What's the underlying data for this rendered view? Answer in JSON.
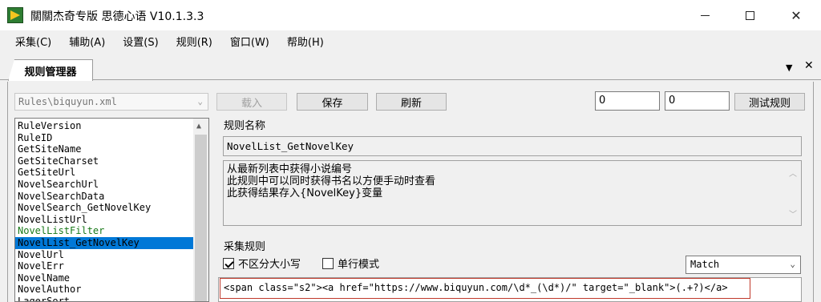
{
  "window": {
    "title": "關關杰奇专版 思德心语 V10.1.3.3",
    "minimize": "—",
    "maximize": "☐",
    "close": "✕"
  },
  "menu": {
    "items": [
      "采集(C)",
      "辅助(A)",
      "设置(S)",
      "规则(R)",
      "窗口(W)",
      "帮助(H)"
    ]
  },
  "tabs": {
    "active": "规则管理器",
    "dropdown_glyph": "▼",
    "close_glyph": "✕"
  },
  "toolbar": {
    "rule_file": "Rules\\biquyun.xml",
    "load_label": "载入",
    "save_label": "保存",
    "refresh_label": "刷新",
    "num1": "0",
    "num2": "0",
    "test_label": "测试规则"
  },
  "rule_list": {
    "items": [
      {
        "label": "RuleVersion",
        "state": "normal"
      },
      {
        "label": "RuleID",
        "state": "normal"
      },
      {
        "label": "GetSiteName",
        "state": "normal"
      },
      {
        "label": "GetSiteCharset",
        "state": "normal"
      },
      {
        "label": "GetSiteUrl",
        "state": "normal"
      },
      {
        "label": "NovelSearchUrl",
        "state": "normal"
      },
      {
        "label": "NovelSearchData",
        "state": "normal"
      },
      {
        "label": "NovelSearch_GetNovelKey",
        "state": "normal"
      },
      {
        "label": "NovelListUrl",
        "state": "normal"
      },
      {
        "label": "NovelListFilter",
        "state": "green"
      },
      {
        "label": "NovelList_GetNovelKey",
        "state": "selected"
      },
      {
        "label": "NovelUrl",
        "state": "normal"
      },
      {
        "label": "NovelErr",
        "state": "normal"
      },
      {
        "label": "NovelName",
        "state": "normal"
      },
      {
        "label": "NovelAuthor",
        "state": "normal"
      },
      {
        "label": "LagerSort",
        "state": "normal"
      }
    ]
  },
  "rule_detail": {
    "name_label": "规则名称",
    "name_value": "NovelList_GetNovelKey",
    "description_lines": [
      "从最新列表中获得小说编号",
      "此规则中可以同时获得书名以方便手动时查看",
      "此获得结果存入{NovelKey}变量"
    ],
    "collect_label": "采集规则",
    "ignore_case_label": "不区分大小写",
    "ignore_case_checked": true,
    "single_line_label": "单行模式",
    "single_line_checked": false,
    "match_mode": "Match",
    "regex": "<span class=\"s2\"><a href=\"https://www.biquyun.com/\\d*_(\\d*)/\" target=\"_blank\">(.+?)</a>"
  },
  "colors": {
    "selection": "#0078d7",
    "green_item": "#1a7a1a",
    "highlight_border": "#c0392b"
  }
}
